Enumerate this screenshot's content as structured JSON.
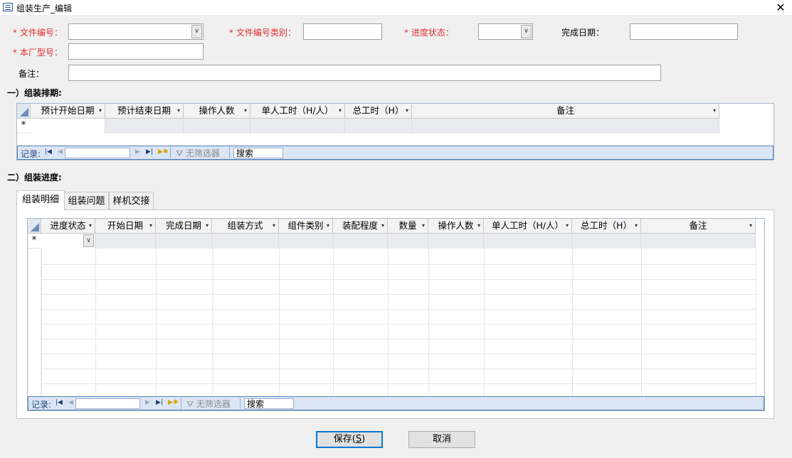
{
  "window": {
    "title": "组装生产_编辑",
    "close_icon": "close-icon"
  },
  "form": {
    "file_no_label": "* 文件编号：",
    "file_no_value": "",
    "file_type_label": "* 文件编号类别：",
    "file_type_value": "",
    "progress_status_label": "* 进度状态：",
    "progress_status_value": "",
    "finish_date_label": "完成日期：",
    "finish_date_value": "",
    "model_label": "* 本厂型号：",
    "model_value": "",
    "remark_label": "备注：",
    "remark_value": ""
  },
  "section1": {
    "title": "一）组装排期:",
    "columns": [
      "预计开始日期",
      "预计结束日期",
      "操作人数",
      "单人工时（H/人）",
      "总工时（H）",
      "备注"
    ],
    "new_row_marker": "*",
    "nav": {
      "records_label": "记录:",
      "no_filter_label": "无筛选器",
      "search_label": "搜索"
    }
  },
  "section2": {
    "title": "二）组装进度:",
    "tabs": [
      "组装明细",
      "组装问题",
      "样机交接"
    ],
    "active_tab": "组装明细",
    "columns": [
      "进度状态",
      "开始日期",
      "完成日期",
      "组装方式",
      "组件类别",
      "装配程度",
      "数量",
      "操作人数",
      "单人工时（H/人）",
      "总工时（H）",
      "备注"
    ],
    "new_row_marker": "*",
    "nav": {
      "records_label": "记录:",
      "no_filter_label": "无筛选器",
      "search_label": "搜索"
    }
  },
  "buttons": {
    "save_text": "保存(",
    "save_key": "S",
    "save_tail": ")",
    "cancel": "取消"
  },
  "colors": {
    "required": "#e0302f",
    "nav_bg": "#dbe6f4",
    "accent": "#0078d7"
  }
}
